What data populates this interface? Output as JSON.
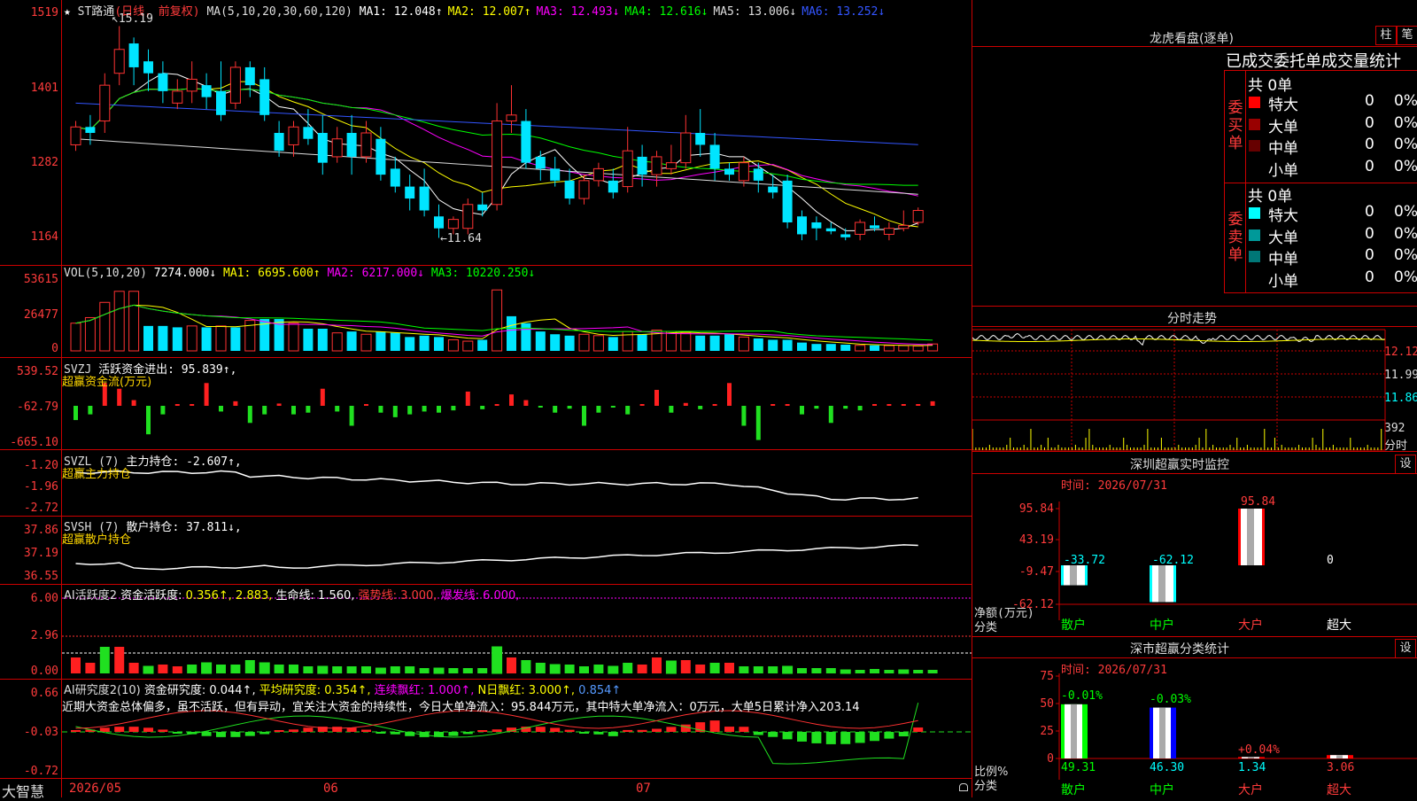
{
  "main": {
    "stock_name": "ST路通",
    "period_note": "(日线, 前复权)",
    "ma_params": "MA(5,10,20,30,60,120)",
    "ma": [
      {
        "label": "MA1: 12.048",
        "arrow": "↑",
        "color": "#ffffff"
      },
      {
        "label": "MA2: 12.007",
        "arrow": "↑",
        "color": "#ffff00"
      },
      {
        "label": "MA3: 12.493",
        "arrow": "↓",
        "color": "#ff00ff"
      },
      {
        "label": "MA4: 12.616",
        "arrow": "↓",
        "color": "#00ff00"
      },
      {
        "label": "MA5: 13.006",
        "arrow": "↓",
        "color": "#dddddd"
      },
      {
        "label": "MA6: 13.252",
        "arrow": "↓",
        "color": "#3355ff"
      }
    ],
    "y_ticks": [
      "1519",
      "1401",
      "1282",
      "1164"
    ],
    "high_mark": "15.19",
    "low_mark": "11.64",
    "star": "★"
  },
  "candles": [
    {
      "o": 13.2,
      "c": 13.5,
      "h": 13.6,
      "l": 13.1
    },
    {
      "o": 13.5,
      "c": 13.4,
      "h": 13.7,
      "l": 13.2
    },
    {
      "o": 13.6,
      "c": 14.2,
      "h": 14.4,
      "l": 13.4
    },
    {
      "o": 14.4,
      "c": 14.8,
      "h": 15.19,
      "l": 14.2
    },
    {
      "o": 14.9,
      "c": 14.5,
      "h": 15.0,
      "l": 14.2
    },
    {
      "o": 14.6,
      "c": 14.4,
      "h": 14.8,
      "l": 14.1
    },
    {
      "o": 14.4,
      "c": 14.1,
      "h": 14.6,
      "l": 13.9
    },
    {
      "o": 13.9,
      "c": 14.1,
      "h": 14.3,
      "l": 13.8
    },
    {
      "o": 14.1,
      "c": 14.3,
      "h": 14.6,
      "l": 13.9
    },
    {
      "o": 14.2,
      "c": 14.0,
      "h": 14.4,
      "l": 13.8
    },
    {
      "o": 14.1,
      "c": 13.7,
      "h": 14.6,
      "l": 13.6
    },
    {
      "o": 13.9,
      "c": 14.5,
      "h": 14.6,
      "l": 13.8
    },
    {
      "o": 14.5,
      "c": 14.2,
      "h": 14.6,
      "l": 14.0
    },
    {
      "o": 14.3,
      "c": 13.7,
      "h": 14.5,
      "l": 13.6
    },
    {
      "o": 13.4,
      "c": 13.1,
      "h": 13.6,
      "l": 13.0
    },
    {
      "o": 13.2,
      "c": 13.5,
      "h": 13.6,
      "l": 13.0
    },
    {
      "o": 13.5,
      "c": 13.3,
      "h": 13.8,
      "l": 13.2
    },
    {
      "o": 13.4,
      "c": 12.9,
      "h": 13.7,
      "l": 12.7
    },
    {
      "o": 13.0,
      "c": 13.3,
      "h": 13.5,
      "l": 12.9
    },
    {
      "o": 13.4,
      "c": 13.0,
      "h": 13.7,
      "l": 12.7
    },
    {
      "o": 13.0,
      "c": 13.4,
      "h": 13.6,
      "l": 12.9
    },
    {
      "o": 13.3,
      "c": 12.7,
      "h": 13.5,
      "l": 12.6
    },
    {
      "o": 12.8,
      "c": 12.5,
      "h": 13.0,
      "l": 12.4
    },
    {
      "o": 12.5,
      "c": 12.3,
      "h": 12.7,
      "l": 12.1
    },
    {
      "o": 12.5,
      "c": 12.1,
      "h": 12.8,
      "l": 12.0
    },
    {
      "o": 12.0,
      "c": 11.8,
      "h": 12.2,
      "l": 11.64
    },
    {
      "o": 11.8,
      "c": 11.95,
      "h": 12.0,
      "l": 11.7
    },
    {
      "o": 11.8,
      "c": 12.2,
      "h": 12.3,
      "l": 11.7
    },
    {
      "o": 12.2,
      "c": 12.1,
      "h": 12.4,
      "l": 12.0
    },
    {
      "o": 12.2,
      "c": 13.6,
      "h": 13.9,
      "l": 12.1
    },
    {
      "o": 13.6,
      "c": 13.7,
      "h": 14.2,
      "l": 13.4
    },
    {
      "o": 13.6,
      "c": 12.9,
      "h": 13.8,
      "l": 12.8
    },
    {
      "o": 13.0,
      "c": 12.8,
      "h": 13.1,
      "l": 12.6
    },
    {
      "o": 12.8,
      "c": 12.6,
      "h": 13.0,
      "l": 12.5
    },
    {
      "o": 12.6,
      "c": 12.3,
      "h": 12.8,
      "l": 12.2
    },
    {
      "o": 12.3,
      "c": 12.6,
      "h": 12.7,
      "l": 12.2
    },
    {
      "o": 12.6,
      "c": 12.8,
      "h": 12.9,
      "l": 12.5
    },
    {
      "o": 12.6,
      "c": 12.4,
      "h": 12.8,
      "l": 12.3
    },
    {
      "o": 12.5,
      "c": 13.1,
      "h": 13.5,
      "l": 12.4
    },
    {
      "o": 13.0,
      "c": 12.7,
      "h": 13.2,
      "l": 12.5
    },
    {
      "o": 12.7,
      "c": 13.0,
      "h": 13.1,
      "l": 12.5
    },
    {
      "o": 12.8,
      "c": 12.9,
      "h": 13.2,
      "l": 12.7
    },
    {
      "o": 12.9,
      "c": 13.4,
      "h": 13.7,
      "l": 12.8
    },
    {
      "o": 13.4,
      "c": 13.2,
      "h": 13.8,
      "l": 13.0
    },
    {
      "o": 13.2,
      "c": 12.8,
      "h": 13.4,
      "l": 12.6
    },
    {
      "o": 12.8,
      "c": 12.7,
      "h": 12.9,
      "l": 12.6
    },
    {
      "o": 12.6,
      "c": 12.9,
      "h": 13.0,
      "l": 12.5
    },
    {
      "o": 12.8,
      "c": 12.6,
      "h": 12.9,
      "l": 12.4
    },
    {
      "o": 12.5,
      "c": 12.4,
      "h": 12.7,
      "l": 12.3
    },
    {
      "o": 12.6,
      "c": 11.9,
      "h": 12.7,
      "l": 11.8
    },
    {
      "o": 12.0,
      "c": 11.7,
      "h": 12.1,
      "l": 11.6
    },
    {
      "o": 11.9,
      "c": 11.8,
      "h": 12.0,
      "l": 11.6
    },
    {
      "o": 11.8,
      "c": 11.75,
      "h": 11.9,
      "l": 11.7
    },
    {
      "o": 11.7,
      "c": 11.65,
      "h": 11.8,
      "l": 11.6
    },
    {
      "o": 11.7,
      "c": 11.9,
      "h": 11.95,
      "l": 11.6
    },
    {
      "o": 11.85,
      "c": 11.8,
      "h": 12.0,
      "l": 11.75
    },
    {
      "o": 11.7,
      "c": 11.8,
      "h": 11.9,
      "l": 11.6
    },
    {
      "o": 11.8,
      "c": 11.85,
      "h": 12.1,
      "l": 11.75
    },
    {
      "o": 11.9,
      "c": 12.1,
      "h": 12.15,
      "l": 11.85
    }
  ],
  "volume": {
    "label": "VOL(5,10,20)",
    "value": "7274.000↓",
    "ma": [
      {
        "label": "MA1: 6695.600↑",
        "color": "#ffff00"
      },
      {
        "label": "MA2: 6217.000↓",
        "color": "#ff00ff"
      },
      {
        "label": "MA3: 10220.250↓",
        "color": "#00ff00"
      }
    ],
    "y_ticks": [
      "53615",
      "26477",
      "0"
    ],
    "bars": [
      20000,
      24000,
      35000,
      43000,
      43000,
      18000,
      18000,
      17000,
      18000,
      17000,
      18000,
      17000,
      22000,
      23000,
      23000,
      20000,
      16000,
      16000,
      13000,
      14000,
      12000,
      14000,
      13000,
      10000,
      11000,
      10000,
      8000,
      7000,
      8000,
      44000,
      25000,
      20000,
      14000,
      12000,
      11000,
      12000,
      11000,
      10000,
      14000,
      12000,
      15000,
      14000,
      13000,
      11000,
      11000,
      12000,
      10000,
      9000,
      8000,
      8000,
      6000,
      5000,
      5000,
      4500,
      4000,
      4000,
      3800,
      3800,
      3500,
      5000
    ],
    "colors": [
      "r",
      "r",
      "r",
      "r",
      "r",
      "c",
      "c",
      "c",
      "r",
      "c",
      "r",
      "c",
      "r",
      "c",
      "c",
      "r",
      "c",
      "c",
      "r",
      "c",
      "r",
      "c",
      "c",
      "c",
      "c",
      "c",
      "r",
      "r",
      "c",
      "r",
      "c",
      "c",
      "c",
      "c",
      "c",
      "r",
      "r",
      "c",
      "r",
      "c",
      "r",
      "r",
      "r",
      "c",
      "c",
      "c",
      "r",
      "c",
      "c",
      "c",
      "c",
      "c",
      "c",
      "c",
      "r",
      "c",
      "r",
      "r",
      "r",
      "r"
    ]
  },
  "svzj": {
    "label": "SVZJ",
    "name": "活跃资金进出:",
    "value": "95.839↑,",
    "sub": "超赢资金流(万元)",
    "y_ticks": [
      "539.52",
      "-62.79",
      "-665.10"
    ],
    "values": [
      -250,
      -150,
      400,
      300,
      100,
      -500,
      -150,
      30,
      30,
      400,
      -100,
      80,
      -300,
      -150,
      40,
      -150,
      -120,
      300,
      -100,
      -350,
      30,
      -120,
      -200,
      -150,
      -100,
      -120,
      -80,
      250,
      -60,
      30,
      200,
      100,
      -30,
      -120,
      -50,
      -350,
      -120,
      -30,
      -150,
      20,
      280,
      -120,
      50,
      -60,
      30,
      400,
      -350,
      -600,
      30,
      30,
      -150,
      -50,
      -300,
      -50,
      -80,
      30,
      30,
      30,
      30,
      80
    ]
  },
  "svzl": {
    "label": "SVZL (7)",
    "name": "主力持仓:",
    "value": "-2.607↑,",
    "sub": "超赢主力持仓",
    "y_ticks": [
      "-1.20",
      "-1.96",
      "-2.72"
    ]
  },
  "svsh": {
    "label": "SVSH (7)",
    "name": "散户持仓:",
    "value": "37.811↓,",
    "sub": "超赢散户持仓",
    "y_ticks": [
      "37.86",
      "37.19",
      "36.55"
    ]
  },
  "ai_huoyue": {
    "label": "AI活跃度2",
    "name": "资金活跃度:",
    "value": "0.356↑, 2.883,",
    "lifeline": "生命线: 1.560,",
    "strong": "强势线: 3.000,",
    "burst": "爆发线: 6.000,",
    "y_ticks": [
      "6.00",
      "2.96",
      "0.00"
    ]
  },
  "ai_yanjiu": {
    "label": "AI研究度2(10)",
    "name": "资金研究度: 0.044↑,",
    "avg": "平均研究度: 0.354↑,",
    "streak": "连续飘红: 1.000↑,",
    "nday": "N日飘红: 3.000↑,",
    "tail": "0.854↑",
    "comment": "近期大资金总体偏多，虽不活跃，但有异动，宜关注大资金的持续性，今日大单净流入：95.844万元，其中特大单净流入：0万元，大单5日累计净入203.14",
    "y_ticks": [
      "0.66",
      "-0.03",
      "-0.72"
    ]
  },
  "footer": {
    "brand": "大智慧",
    "dates": [
      "2026/05",
      "06",
      "07"
    ]
  },
  "right": {
    "lhb_title": "龙虎看盘(逐单)",
    "lhb_btns": [
      "柱",
      "笔"
    ],
    "tabs_label": "已成交委托单成交量统计",
    "buy": {
      "label": [
        "委",
        "买",
        "单"
      ],
      "total": "共 0单",
      "rows": [
        {
          "name": "特大",
          "n": "0",
          "p": "0%",
          "color": "#ff0000"
        },
        {
          "name": "大单",
          "n": "0",
          "p": "0%",
          "color": "#990000"
        },
        {
          "name": "中单",
          "n": "0",
          "p": "0%",
          "color": "#660000"
        },
        {
          "name": "小单",
          "n": "0",
          "p": "0%",
          "color": "#000000"
        }
      ]
    },
    "sell": {
      "label": [
        "委",
        "卖",
        "单"
      ],
      "total": "共 0单",
      "rows": [
        {
          "name": "特大",
          "n": "0",
          "p": "0%",
          "color": "#00ffff"
        },
        {
          "name": "大单",
          "n": "0",
          "p": "0%",
          "color": "#009999"
        },
        {
          "name": "中单",
          "n": "0",
          "p": "0%",
          "color": "#007777"
        },
        {
          "name": "小单",
          "n": "0",
          "p": "0%",
          "color": "#000000"
        }
      ]
    },
    "fenshi_title": "分时走势",
    "fenshi_ticks": [
      "12.12",
      "11.99",
      "11.86",
      "392",
      "分时"
    ],
    "sz_title": "深圳超赢实时监控",
    "sz_btn": "设",
    "sz_time": "时间: 2026/07/31",
    "sz_ticks": [
      "95.84",
      "43.19",
      "-9.47",
      "-62.12"
    ],
    "sz_axis_label": "净额(万元)",
    "sz_cat_label": "分类",
    "sz_cats": [
      "散户",
      "中户",
      "大户",
      "超大"
    ],
    "sz_values": [
      -33.72,
      -62.12,
      95.84,
      0
    ],
    "sz_value_labels": [
      "-33.72",
      "-62.12",
      "95.84",
      "0"
    ],
    "ss_title": "深市超赢分类统计",
    "ss_btn": "设",
    "ss_time": "时间: 2026/07/31",
    "ss_ticks": [
      "75",
      "50",
      "25",
      "0"
    ],
    "ss_axis_label": "比例%",
    "ss_cat_label": "分类",
    "ss_cats": [
      "散户",
      "中户",
      "大户",
      "超大"
    ],
    "ss_values": [
      49.31,
      46.3,
      1.34,
      3.06
    ],
    "ss_top_labels": [
      "-0.01%",
      "-0.03%",
      "+0.04%",
      ""
    ],
    "ss_bottom_labels": [
      "49.31",
      "46.30",
      "1.34",
      "3.06"
    ]
  }
}
